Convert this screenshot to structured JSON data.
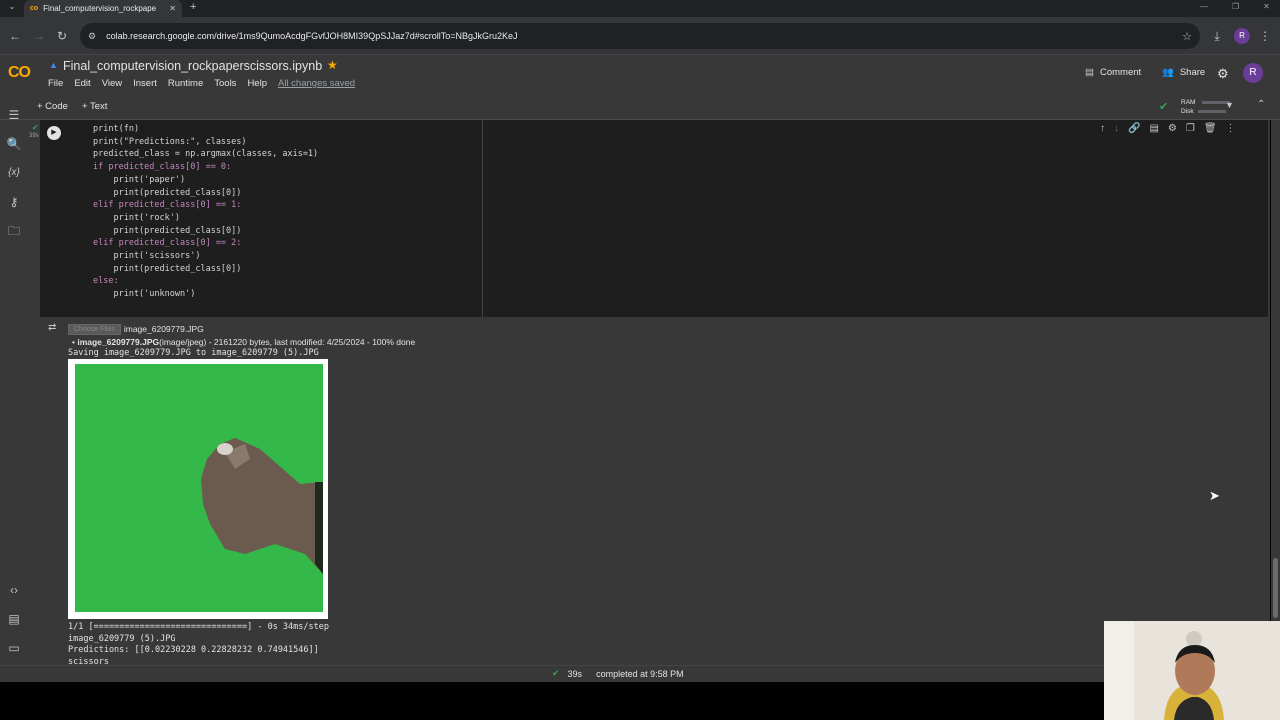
{
  "browser": {
    "tab_title": "Final_computervision_rockpape",
    "url": "colab.research.google.com/drive/1ms9QumoAcdgFGvfJOH8MI39QpSJJaz7d#scrollTo=NBgJkGru2KeJ",
    "profile_initial": "R"
  },
  "colab": {
    "logo_text": "CO",
    "notebook_name": "Final_computervision_rockpaperscissors.ipynb",
    "menu": [
      "File",
      "Edit",
      "View",
      "Insert",
      "Runtime",
      "Tools",
      "Help"
    ],
    "saved_status": "All changes saved",
    "comment_label": "Comment",
    "share_label": "Share",
    "avatar_initial": "R",
    "add_code_label": "+ Code",
    "add_text_label": "+ Text",
    "ram_label": "RAM",
    "disk_label": "Disk"
  },
  "cell": {
    "exec_time": "39s",
    "code_lines": [
      "print(fn)",
      "print(\"Predictions:\", classes)",
      "predicted_class = np.argmax(classes, axis=1)",
      "if predicted_class[0] == 0:",
      "    print('paper')",
      "    print(predicted_class[0])",
      "elif predicted_class[0] == 1:",
      "    print('rock')",
      "    print(predicted_class[0])",
      "elif predicted_class[0] == 2:",
      "    print('scissors')",
      "    print(predicted_class[0])",
      "else:",
      "    print('unknown')"
    ]
  },
  "output": {
    "choose_files_label": "Choose Files",
    "chosen_file": "image_6209779.JPG",
    "file_info_name": "image_6209779.JPG",
    "file_info_detail": "(image/jpeg) - 2161220 bytes, last modified: 4/25/2024 - 100% done",
    "saving_line": "Saving image_6209779.JPG to image_6209779 (5).JPG",
    "progress_line": "1/1 [==============================] - 0s 34ms/step",
    "filename_line": "image_6209779 (5).JPG",
    "predictions_line": "Predictions: [[0.02230228 0.22828232 0.74941546]]",
    "result_line": "scissors"
  },
  "status": {
    "time": "39s",
    "completed": "completed at 9:58 PM"
  },
  "colors": {
    "green_screen": "#34b84a",
    "accent_orange": "#f9ab00",
    "check_green": "#34a853"
  }
}
